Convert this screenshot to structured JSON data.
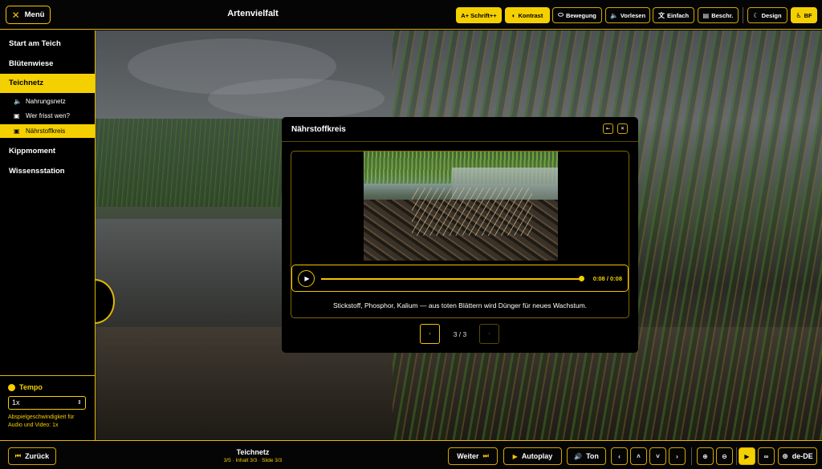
{
  "header": {
    "menu_label": "Menü",
    "title": "Artenvielfalt",
    "toolbar": [
      {
        "label": "A+ Schrift++",
        "icon": "",
        "active": true
      },
      {
        "label": "Kontrast",
        "icon": "contrast-icon",
        "active": true
      },
      {
        "label": "Bewegung",
        "icon": "motion-icon",
        "active": false
      },
      {
        "label": "Vorlesen",
        "icon": "speaker-icon",
        "active": false
      },
      {
        "label": "Einfach",
        "icon": "translate-icon",
        "active": false
      },
      {
        "label": "Beschr.",
        "icon": "document-icon",
        "active": false
      },
      {
        "label": "Design",
        "icon": "moon-icon",
        "active": false
      },
      {
        "label": "BF",
        "icon": "accessibility-icon",
        "active": true
      }
    ]
  },
  "sidebar": {
    "items": [
      {
        "label": "Start am Teich",
        "active": false
      },
      {
        "label": "Blütenwiese",
        "active": false
      },
      {
        "label": "Teichnetz",
        "active": true
      },
      {
        "label": "Kippmoment",
        "active": false
      },
      {
        "label": "Wissensstation",
        "active": false
      }
    ],
    "subitems": [
      {
        "label": "Nahrungsnetz",
        "icon": "speaker-icon",
        "active": false
      },
      {
        "label": "Wer frisst wen?",
        "icon": "gallery-icon",
        "active": false
      },
      {
        "label": "Nährstoffkreis",
        "icon": "gallery-icon",
        "active": true
      }
    ],
    "tempo": {
      "title": "Tempo",
      "value": "1x",
      "note": "Abspielgeschwindigkeit für Audio und Video: 1x"
    }
  },
  "modal": {
    "title": "Nährstoffkreis",
    "player": {
      "time": "0:08 / 0:08",
      "progress": 1.0
    },
    "caption": "Stickstoff, Phosphor, Kalium — aus toten Blättern wird Dünger für neues Wachstum.",
    "pager": {
      "count": "3 / 3"
    }
  },
  "footer": {
    "back_label": "Zurück",
    "crumb_title": "Teichnetz",
    "crumb_sub": "3/5 · Inhalt 3/3 · Slide 3/3",
    "next_label": "Weiter",
    "autoplay_label": "Autoplay",
    "sound_label": "Ton",
    "lang_label": "de-DE"
  },
  "colors": {
    "accent": "#f5d000",
    "border": "#e0b800",
    "background": "#000000"
  }
}
